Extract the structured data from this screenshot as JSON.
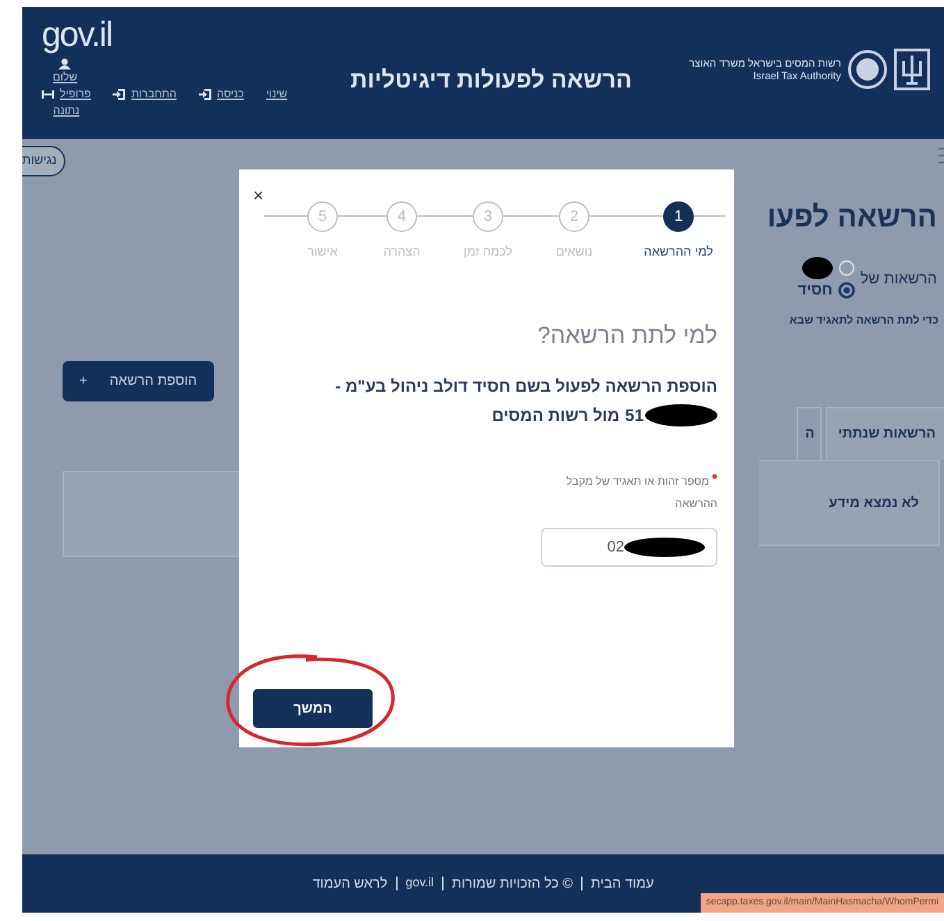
{
  "header": {
    "logo": "gov.il",
    "user_greeting": {
      "label": "שלום",
      "kind": "user"
    },
    "user_links": [
      {
        "label": "שינוי",
        "kind": "text"
      },
      {
        "label": "כניסה",
        "kind": "login"
      },
      {
        "label": "התחברות",
        "kind": "login"
      },
      {
        "label": "פרופיל",
        "kind": "switch",
        "extra": "נתונה"
      }
    ],
    "title": "הרשאה לפעולות דיגיטליות",
    "authority_he": "רשות המסים בישראל משרד האוצר",
    "authority_en": "Israel Tax Authority"
  },
  "accessibility_button": "נגישות",
  "background_page": {
    "title": "הרשאה לפעו",
    "owner_label": "הרשאות של",
    "owner_options": [
      {
        "selected": false,
        "redacted": true
      },
      {
        "label": "חסיד",
        "selected": true,
        "redacted": false
      }
    ],
    "hint": "כדי לתת הרשאה לתאגיד שבא",
    "add_button": "הוספת הרשאה",
    "add_icon": "+",
    "tabs": [
      {
        "label": "הרשאות שנתתי",
        "selected": true
      },
      {
        "label": "ה",
        "selected": false
      }
    ],
    "empty_message": "לא נמצא מידע"
  },
  "dialog": {
    "close": "×",
    "steps": [
      {
        "number": "1",
        "label": "למי ההרשאה",
        "selected": true
      },
      {
        "number": "2",
        "label": "נושאים",
        "selected": false
      },
      {
        "number": "3",
        "label": "לכמה זמן",
        "selected": false
      },
      {
        "number": "4",
        "label": "הצהרה",
        "selected": false
      },
      {
        "number": "5",
        "label": "אישור",
        "selected": false
      }
    ],
    "heading": "למי לתת הרשאה?",
    "description_line": "הוספת הרשאה לפעול בשם חסיד דולב ניהול בע\"מ -",
    "id_prefix": "51",
    "id_redacted": true,
    "description_tail": "מול רשות המסים",
    "field": {
      "label": "מספר זהות או תאגיד של מקבל ההרשאה",
      "required": true,
      "value": "02",
      "redacted": true
    },
    "continue_button": "המשך"
  },
  "annotation": {
    "kind": "circle",
    "color": "#d8262b"
  },
  "footer": {
    "links": [
      {
        "label": "עמוד הבית",
        "kind": "text"
      },
      {
        "label": "© כל הזכויות שמורות",
        "kind": "text"
      },
      {
        "label": "gov.il",
        "kind": "logo"
      },
      {
        "label": "לראש העמוד",
        "kind": "text"
      }
    ]
  },
  "status_url": "secapp.taxes.gov.il/main/MainHasmacha/WhomPermi"
}
